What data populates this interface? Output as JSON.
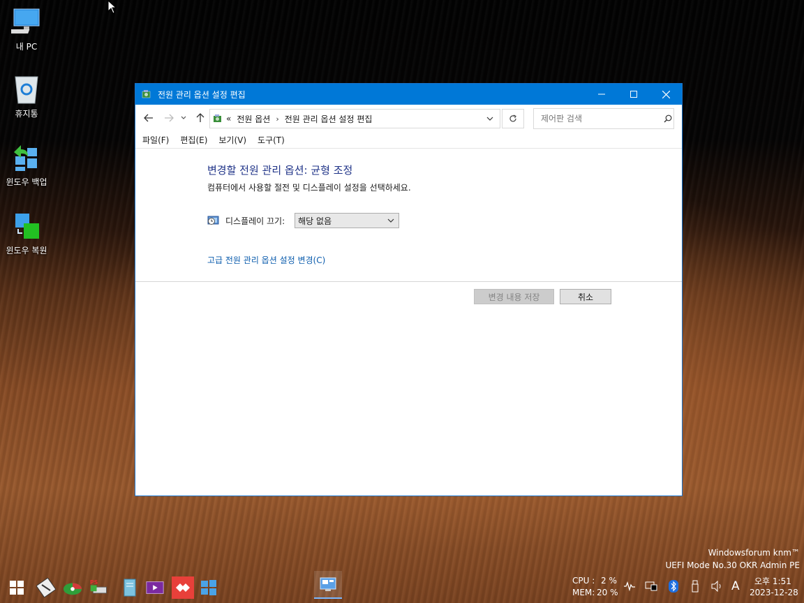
{
  "desktop": {
    "icons": [
      {
        "label": "내 PC",
        "icon": "computer-icon"
      },
      {
        "label": "휴지통",
        "icon": "recycle-bin-icon"
      },
      {
        "label": "윈도우 백업",
        "icon": "backup-icon"
      },
      {
        "label": "윈도우 복원",
        "icon": "restore-icon"
      }
    ],
    "watermark": {
      "line1": "Windowsforum knm™",
      "line2": "UEFI Mode No.30 OKR Admin PE"
    }
  },
  "window": {
    "title": "전원 관리 옵션 설정 편집",
    "address": {
      "prefix": "«",
      "crumbs": [
        "전원 옵션",
        "전원 관리 옵션 설정 편집"
      ]
    },
    "search_placeholder": "제어판 검색",
    "menu": [
      "파일(F)",
      "편집(E)",
      "보기(V)",
      "도구(T)"
    ],
    "heading": "변경할 전원 관리 옵션: 균형 조정",
    "subheading": "컴퓨터에서 사용할 절전 및 디스플레이 설정을 선택하세요.",
    "display_off_label": "디스플레이 끄기:",
    "display_off_value": "해당 없음",
    "advanced_link": "고급 전원 관리 옵션 설정 변경(C)",
    "save_button": "변경 내용 저장",
    "cancel_button": "취소",
    "accent": "#0078d7"
  },
  "taskbar": {
    "cpu_label": "CPU :",
    "cpu_value": "2 %",
    "mem_label": "MEM:",
    "mem_value": "20 %",
    "ime": "A",
    "time": "오후 1:51",
    "date": "2023-12-28"
  }
}
